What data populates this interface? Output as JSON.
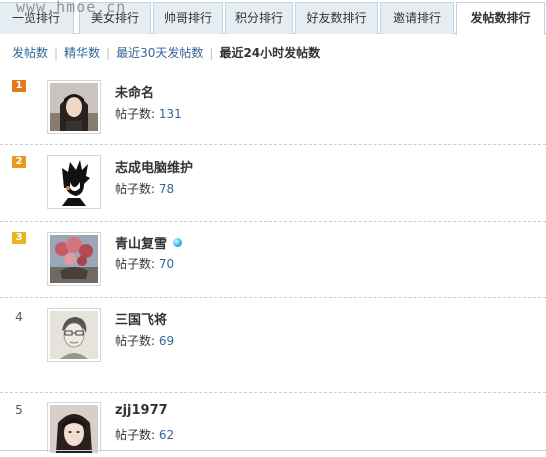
{
  "tabs": [
    {
      "label": "一览排行",
      "active": false
    },
    {
      "label": "美女排行",
      "active": false
    },
    {
      "label": "帅哥排行",
      "active": false
    },
    {
      "label": "积分排行",
      "active": false
    },
    {
      "label": "好友数排行",
      "active": false
    },
    {
      "label": "邀请排行",
      "active": false
    },
    {
      "label": "发帖数排行",
      "active": true
    }
  ],
  "watermark": "www.hmoe.cn",
  "subnav": {
    "items": [
      {
        "label": "发帖数"
      },
      {
        "label": "精华数"
      },
      {
        "label": "最近30天发帖数"
      }
    ],
    "current": "最近24小时发帖数",
    "separator": "|"
  },
  "list": {
    "posts_label": "帖子数:",
    "users": [
      {
        "rank": "1",
        "name": "未命名",
        "posts": "131",
        "badge": false
      },
      {
        "rank": "2",
        "name": "志成电脑维护",
        "posts": "78",
        "badge": false
      },
      {
        "rank": "3",
        "name": "青山复雪",
        "posts": "70",
        "badge": true
      },
      {
        "rank": "4",
        "name": "三国飞将",
        "posts": "69",
        "badge": false
      },
      {
        "rank": "5",
        "name": "zjj1977",
        "posts": "62",
        "badge": false
      }
    ]
  },
  "colors": {
    "link": "#336699",
    "tab_bg": "#e5edf2",
    "border": "#c2d5e3",
    "rank1": "#e4791a",
    "rank2": "#e89a1a",
    "rank3": "#e7b51f"
  }
}
